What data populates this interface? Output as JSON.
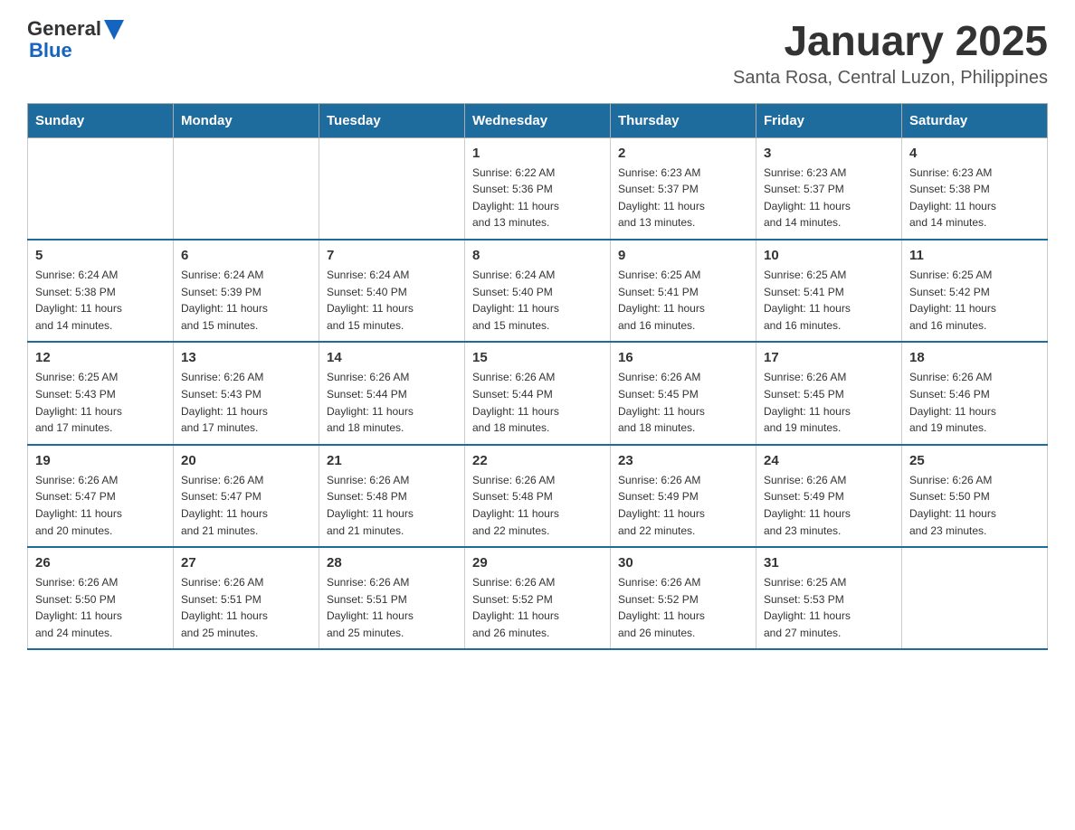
{
  "header": {
    "logo_general": "General",
    "logo_blue": "Blue",
    "month_year": "January 2025",
    "location": "Santa Rosa, Central Luzon, Philippines"
  },
  "days_of_week": [
    "Sunday",
    "Monday",
    "Tuesday",
    "Wednesday",
    "Thursday",
    "Friday",
    "Saturday"
  ],
  "weeks": [
    {
      "days": [
        {
          "num": "",
          "info": ""
        },
        {
          "num": "",
          "info": ""
        },
        {
          "num": "",
          "info": ""
        },
        {
          "num": "1",
          "info": "Sunrise: 6:22 AM\nSunset: 5:36 PM\nDaylight: 11 hours\nand 13 minutes."
        },
        {
          "num": "2",
          "info": "Sunrise: 6:23 AM\nSunset: 5:37 PM\nDaylight: 11 hours\nand 13 minutes."
        },
        {
          "num": "3",
          "info": "Sunrise: 6:23 AM\nSunset: 5:37 PM\nDaylight: 11 hours\nand 14 minutes."
        },
        {
          "num": "4",
          "info": "Sunrise: 6:23 AM\nSunset: 5:38 PM\nDaylight: 11 hours\nand 14 minutes."
        }
      ]
    },
    {
      "days": [
        {
          "num": "5",
          "info": "Sunrise: 6:24 AM\nSunset: 5:38 PM\nDaylight: 11 hours\nand 14 minutes."
        },
        {
          "num": "6",
          "info": "Sunrise: 6:24 AM\nSunset: 5:39 PM\nDaylight: 11 hours\nand 15 minutes."
        },
        {
          "num": "7",
          "info": "Sunrise: 6:24 AM\nSunset: 5:40 PM\nDaylight: 11 hours\nand 15 minutes."
        },
        {
          "num": "8",
          "info": "Sunrise: 6:24 AM\nSunset: 5:40 PM\nDaylight: 11 hours\nand 15 minutes."
        },
        {
          "num": "9",
          "info": "Sunrise: 6:25 AM\nSunset: 5:41 PM\nDaylight: 11 hours\nand 16 minutes."
        },
        {
          "num": "10",
          "info": "Sunrise: 6:25 AM\nSunset: 5:41 PM\nDaylight: 11 hours\nand 16 minutes."
        },
        {
          "num": "11",
          "info": "Sunrise: 6:25 AM\nSunset: 5:42 PM\nDaylight: 11 hours\nand 16 minutes."
        }
      ]
    },
    {
      "days": [
        {
          "num": "12",
          "info": "Sunrise: 6:25 AM\nSunset: 5:43 PM\nDaylight: 11 hours\nand 17 minutes."
        },
        {
          "num": "13",
          "info": "Sunrise: 6:26 AM\nSunset: 5:43 PM\nDaylight: 11 hours\nand 17 minutes."
        },
        {
          "num": "14",
          "info": "Sunrise: 6:26 AM\nSunset: 5:44 PM\nDaylight: 11 hours\nand 18 minutes."
        },
        {
          "num": "15",
          "info": "Sunrise: 6:26 AM\nSunset: 5:44 PM\nDaylight: 11 hours\nand 18 minutes."
        },
        {
          "num": "16",
          "info": "Sunrise: 6:26 AM\nSunset: 5:45 PM\nDaylight: 11 hours\nand 18 minutes."
        },
        {
          "num": "17",
          "info": "Sunrise: 6:26 AM\nSunset: 5:45 PM\nDaylight: 11 hours\nand 19 minutes."
        },
        {
          "num": "18",
          "info": "Sunrise: 6:26 AM\nSunset: 5:46 PM\nDaylight: 11 hours\nand 19 minutes."
        }
      ]
    },
    {
      "days": [
        {
          "num": "19",
          "info": "Sunrise: 6:26 AM\nSunset: 5:47 PM\nDaylight: 11 hours\nand 20 minutes."
        },
        {
          "num": "20",
          "info": "Sunrise: 6:26 AM\nSunset: 5:47 PM\nDaylight: 11 hours\nand 21 minutes."
        },
        {
          "num": "21",
          "info": "Sunrise: 6:26 AM\nSunset: 5:48 PM\nDaylight: 11 hours\nand 21 minutes."
        },
        {
          "num": "22",
          "info": "Sunrise: 6:26 AM\nSunset: 5:48 PM\nDaylight: 11 hours\nand 22 minutes."
        },
        {
          "num": "23",
          "info": "Sunrise: 6:26 AM\nSunset: 5:49 PM\nDaylight: 11 hours\nand 22 minutes."
        },
        {
          "num": "24",
          "info": "Sunrise: 6:26 AM\nSunset: 5:49 PM\nDaylight: 11 hours\nand 23 minutes."
        },
        {
          "num": "25",
          "info": "Sunrise: 6:26 AM\nSunset: 5:50 PM\nDaylight: 11 hours\nand 23 minutes."
        }
      ]
    },
    {
      "days": [
        {
          "num": "26",
          "info": "Sunrise: 6:26 AM\nSunset: 5:50 PM\nDaylight: 11 hours\nand 24 minutes."
        },
        {
          "num": "27",
          "info": "Sunrise: 6:26 AM\nSunset: 5:51 PM\nDaylight: 11 hours\nand 25 minutes."
        },
        {
          "num": "28",
          "info": "Sunrise: 6:26 AM\nSunset: 5:51 PM\nDaylight: 11 hours\nand 25 minutes."
        },
        {
          "num": "29",
          "info": "Sunrise: 6:26 AM\nSunset: 5:52 PM\nDaylight: 11 hours\nand 26 minutes."
        },
        {
          "num": "30",
          "info": "Sunrise: 6:26 AM\nSunset: 5:52 PM\nDaylight: 11 hours\nand 26 minutes."
        },
        {
          "num": "31",
          "info": "Sunrise: 6:25 AM\nSunset: 5:53 PM\nDaylight: 11 hours\nand 27 minutes."
        },
        {
          "num": "",
          "info": ""
        }
      ]
    }
  ]
}
